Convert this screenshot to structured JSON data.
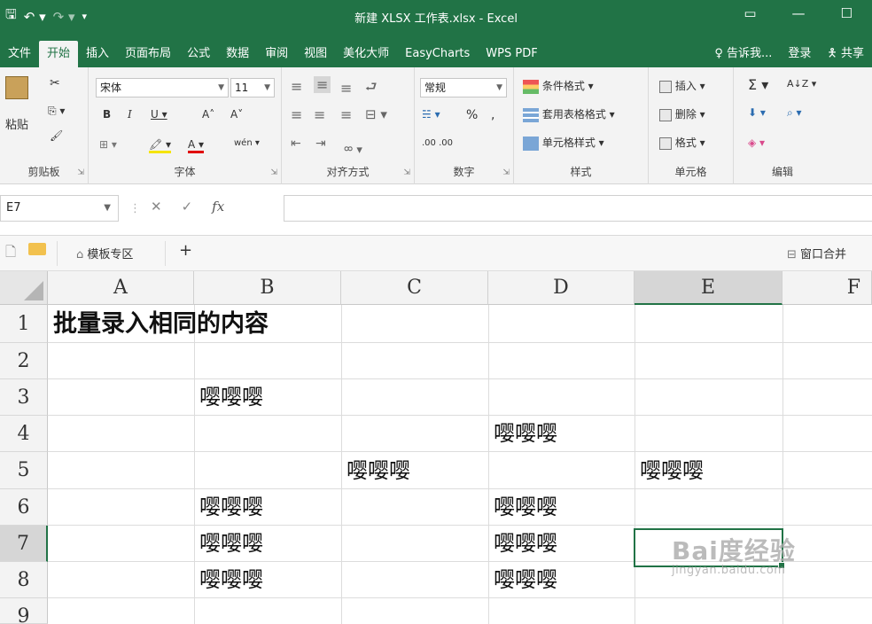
{
  "window": {
    "title": "新建 XLSX 工作表.xlsx - Excel",
    "controls": [
      "▭",
      "—",
      "☐"
    ]
  },
  "qat": {
    "save": "🖫",
    "undo": "↶ ▾",
    "redo": "↷ ▾",
    "customize": "▾"
  },
  "menu": {
    "tabs": [
      "文件",
      "开始",
      "插入",
      "页面布局",
      "公式",
      "数据",
      "审阅",
      "视图",
      "美化大师",
      "EasyCharts",
      "WPS PDF"
    ],
    "active_tab": "开始",
    "tell_me": "♀ 告诉我...",
    "login": "登录",
    "share": "🯅 共享"
  },
  "ribbon": {
    "clipboard": {
      "label": "剪贴板",
      "paste": "粘贴",
      "cut": "✂",
      "copy": "⎘ ▾",
      "format_painter": "🖌"
    },
    "font": {
      "label": "字体",
      "font_name": "宋体",
      "font_size": "11",
      "bold": "B",
      "italic": "I",
      "underline": "U ▾",
      "grow": "A˄",
      "shrink": "A˅",
      "border": "⊞ ▾",
      "fill": "🖍 ▾",
      "color": "A ▾",
      "phonetic": "wén ▾"
    },
    "alignment": {
      "label": "对齐方式",
      "orientation": "ᢁ ▾"
    },
    "number": {
      "label": "数字",
      "format": "常规",
      "currency": "☵ ▾",
      "percent": "%",
      "comma": ",",
      "inc_dec": ".00 .00"
    },
    "styles": {
      "label": "样式",
      "conditional": "条件格式 ▾",
      "table": "套用表格格式 ▾",
      "cell": "单元格样式 ▾"
    },
    "cells": {
      "label": "单元格",
      "insert": "插入 ▾",
      "delete": "删除 ▾",
      "format": "格式 ▾"
    },
    "editing": {
      "label": "编辑",
      "sum": "Σ ▾",
      "sort": "A↓Z ▾",
      "fill": "⬇ ▾",
      "find": "⌕ ▾",
      "clear": "◈ ▾"
    }
  },
  "formula_bar": {
    "name_box": "E7",
    "cancel": "✕",
    "enter": "✓",
    "fx": "fx",
    "value": ""
  },
  "doc_tabs": {
    "template_area": "模板专区",
    "add": "+",
    "merge_window": "窗口合并"
  },
  "sheet": {
    "columns": [
      "A",
      "B",
      "C",
      "D",
      "E",
      "F"
    ],
    "rows": [
      "1",
      "2",
      "3",
      "4",
      "5",
      "6",
      "7",
      "8",
      "9"
    ],
    "selected_column": "E",
    "selected_row": "7",
    "cells": {
      "A1": "批量录入相同的内容",
      "B3": "嘤嘤嘤",
      "D4": "嘤嘤嘤",
      "C5": "嘤嘤嘤",
      "E5": "嘤嘤嘤",
      "B6": "嘤嘤嘤",
      "D6": "嘤嘤嘤",
      "B7": "嘤嘤嘤",
      "D7": "嘤嘤嘤",
      "B8": "嘤嘤嘤",
      "D8": "嘤嘤嘤"
    }
  },
  "watermark": {
    "brand": "Bai度经验",
    "url": "jingyan.baidu.com"
  }
}
